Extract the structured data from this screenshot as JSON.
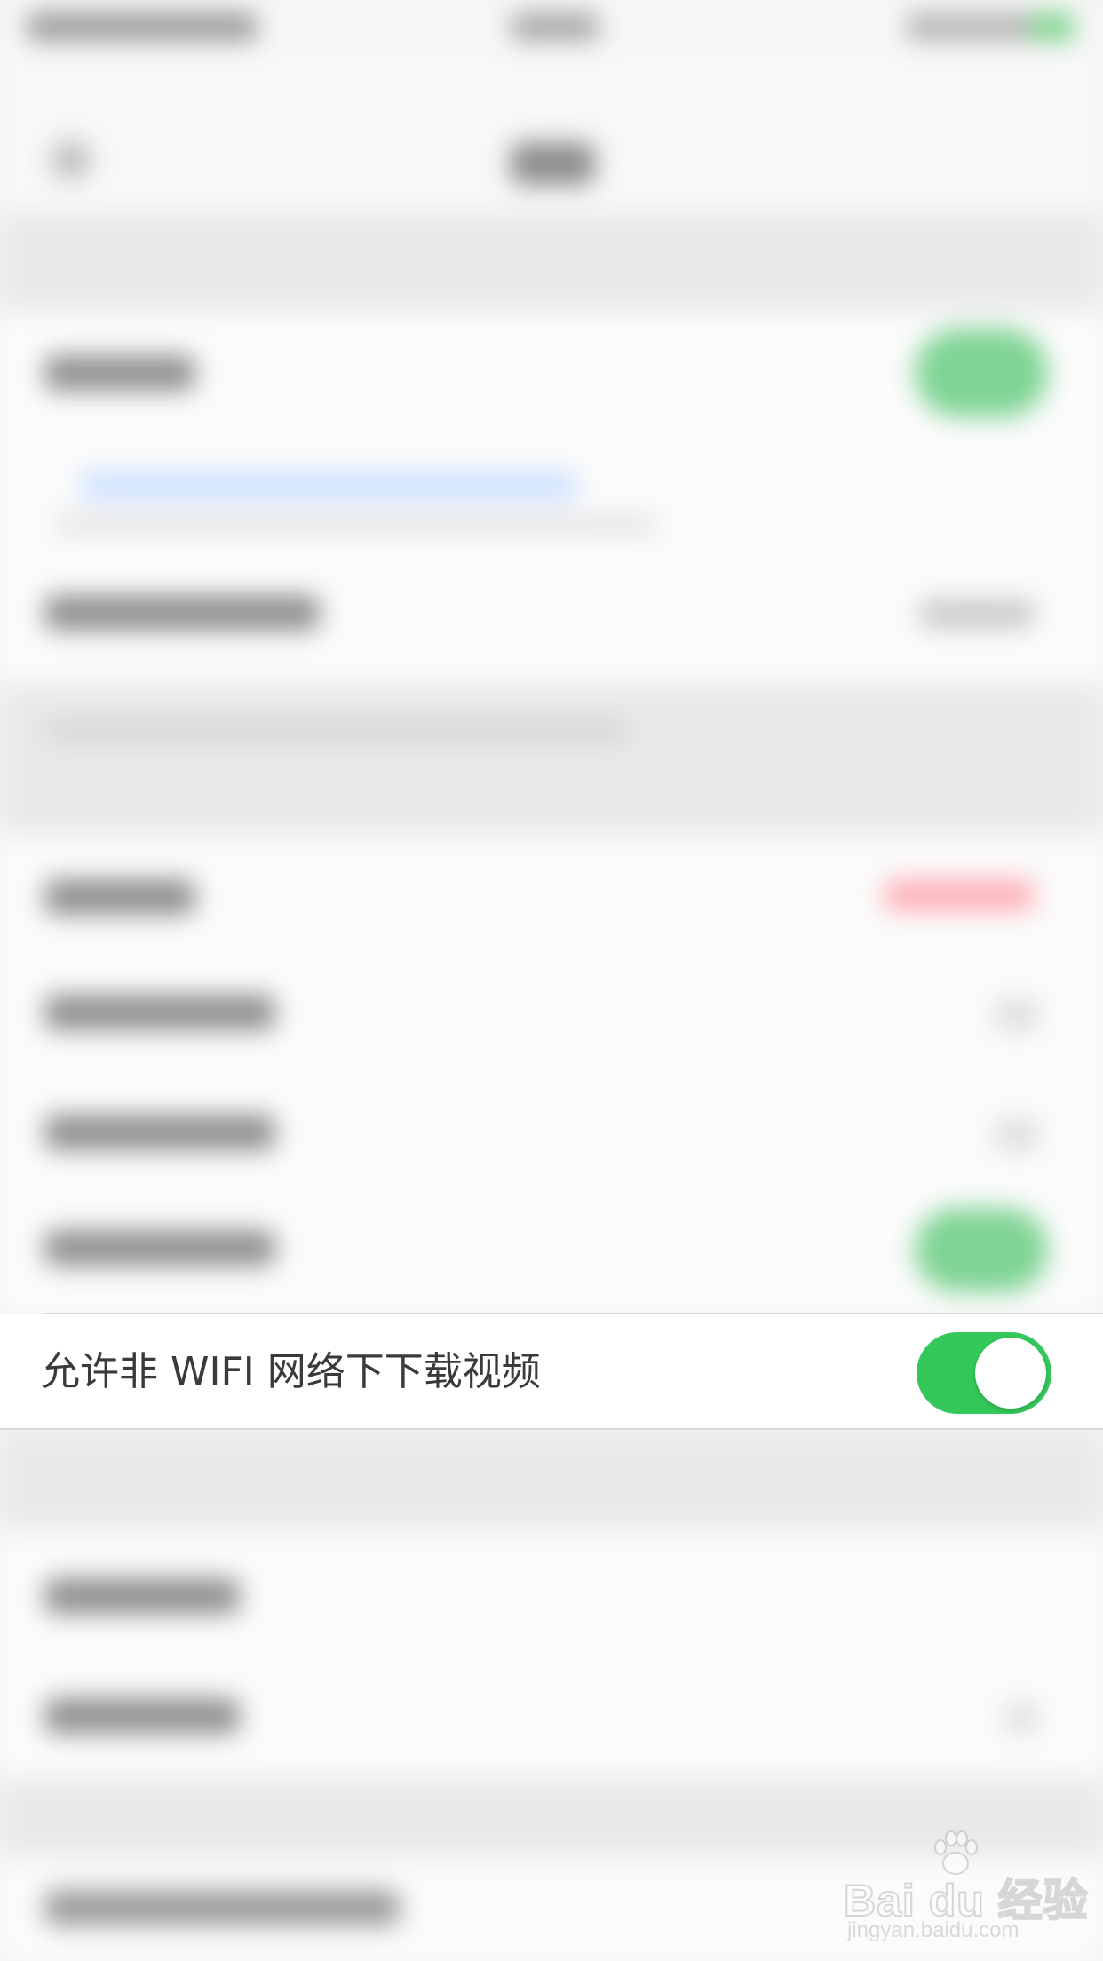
{
  "setting_row": {
    "label": "允许非 WIFI 网络下下载视频",
    "toggle_on": true,
    "toggle_color": "#34c759"
  },
  "watermark": {
    "logo_text": "Bai du 经验",
    "url": "jingyan.baidu.com",
    "icon": "baidu-paw-icon"
  },
  "colors": {
    "background": "#f4f4f4",
    "row_background": "#ffffff",
    "accent_green": "#34c759",
    "blurred_link_blue": "#cfe2ff",
    "blurred_alert_red": "#ffb0b8"
  }
}
